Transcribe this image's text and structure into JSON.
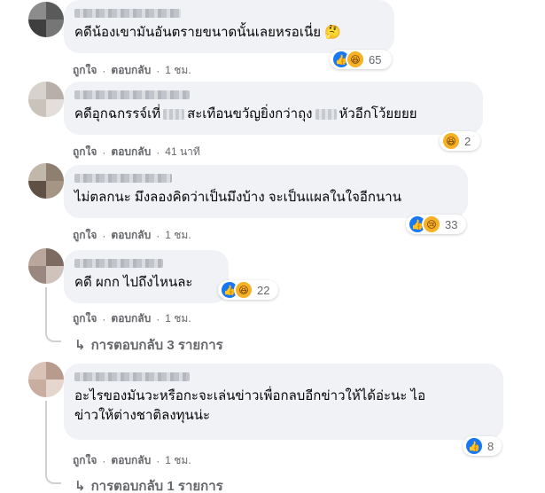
{
  "comments": [
    {
      "text": "คดีน้องเขามันอันตรายขนาดนั้นเลยหรอเนี่ย 🤔",
      "reaction_count": "65",
      "reaction_icons": [
        "like-icon",
        "haha-icon"
      ],
      "like_label": "ถูกใจ",
      "reply_label": "ตอบกลับ",
      "time": "1 ชม."
    },
    {
      "text_before": "คดีอุกฉกรรจ์เที่",
      "text_middle": "สะเทือนขวัญยิ่งกว่าถุง",
      "text_after": "หัวอีกโว้ยยยย",
      "reaction_count": "2",
      "reaction_icons": [
        "haha-icon"
      ],
      "like_label": "ถูกใจ",
      "reply_label": "ตอบกลับ",
      "time": "41 นาที"
    },
    {
      "text": "ไม่ตลกนะ มึงลองคิดว่าเป็นมึงบ้าง จะเป็นแผลในใจอีกนาน",
      "reaction_count": "33",
      "reaction_icons": [
        "like-icon",
        "sad-icon"
      ],
      "like_label": "ถูกใจ",
      "reply_label": "ตอบกลับ",
      "time": "1 ชม."
    },
    {
      "text": "คดี ผกก ไปถึงไหนละ",
      "reaction_count": "22",
      "reaction_icons": [
        "like-icon",
        "haha-icon"
      ],
      "like_label": "ถูกใจ",
      "reply_label": "ตอบกลับ",
      "time": "1 ชม.",
      "replies_label": "การตอบกลับ 3 รายการ"
    },
    {
      "text_line1": "อะไรของมันวะหรือกะจะเล่นข่าวเพื่อกลบอีกข่าวให้ได้อ่ะนะ ไอ",
      "text_line2": "ข่าวให้ต่างชาติลงทุนน่ะ",
      "reaction_count": "8",
      "reaction_icons": [
        "like-icon"
      ],
      "like_label": "ถูกใจ",
      "reply_label": "ตอบกลับ",
      "time": "1 ชม.",
      "replies_label": "การตอบกลับ 1 รายการ"
    }
  ],
  "glyphs": {
    "dot": "·",
    "reply_arrow": "↳",
    "like": "👍",
    "haha": "😆",
    "sad": "😢"
  },
  "colors": {
    "bubble": "#f0f2f5",
    "like_blue": "#1877f2",
    "emoji_yellow": "#f7b125",
    "meta_gray": "#65676b"
  }
}
